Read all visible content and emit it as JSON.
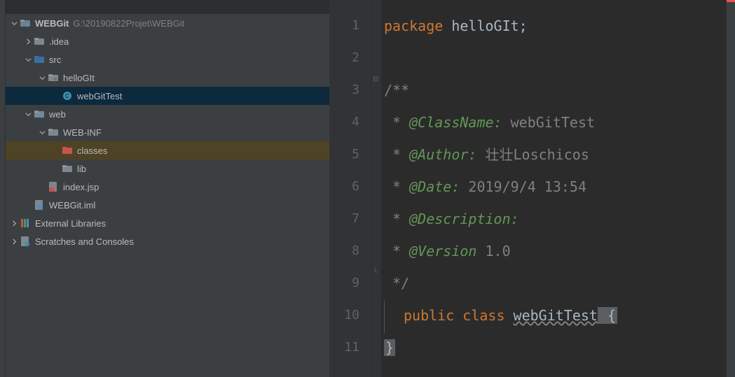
{
  "project": {
    "root": {
      "name": "WEBGit",
      "path": "G:\\20190822Projet\\WEBGit"
    },
    "nodes": {
      "idea": ".idea",
      "src": "src",
      "helloGIt": "helloGIt",
      "webGitTest": "webGitTest",
      "web": "web",
      "webinf": "WEB-INF",
      "classes": "classes",
      "lib": "lib",
      "indexjsp": "index.jsp",
      "iml": "WEBGit.iml",
      "extLib": "External Libraries",
      "scratches": "Scratches and Consoles"
    }
  },
  "editor": {
    "lines": [
      "1",
      "2",
      "3",
      "4",
      "5",
      "6",
      "7",
      "8",
      "9",
      "10",
      "11"
    ],
    "l1_kw": "package",
    "l1_pkg": " helloGIt",
    "l1_semi": ";",
    "l3": "/**",
    "l4_star": " * ",
    "l4_tag": "@ClassName:",
    "l4_val": " webGitTest",
    "l5_star": " * ",
    "l5_tag": "@Author:",
    "l5_val": " 壮壮Loschicos",
    "l6_star": " * ",
    "l6_tag": "@Date:",
    "l6_val": " 2019/9/4 13:54",
    "l7_star": " * ",
    "l7_tag": "@Description:",
    "l8_star": " * ",
    "l8_tag": "@Version",
    "l8_val": " 1.0",
    "l9": " */",
    "l10_kw": "public class ",
    "l10_name": "webGitTest",
    "l10_brace": " {",
    "l11": "}"
  }
}
